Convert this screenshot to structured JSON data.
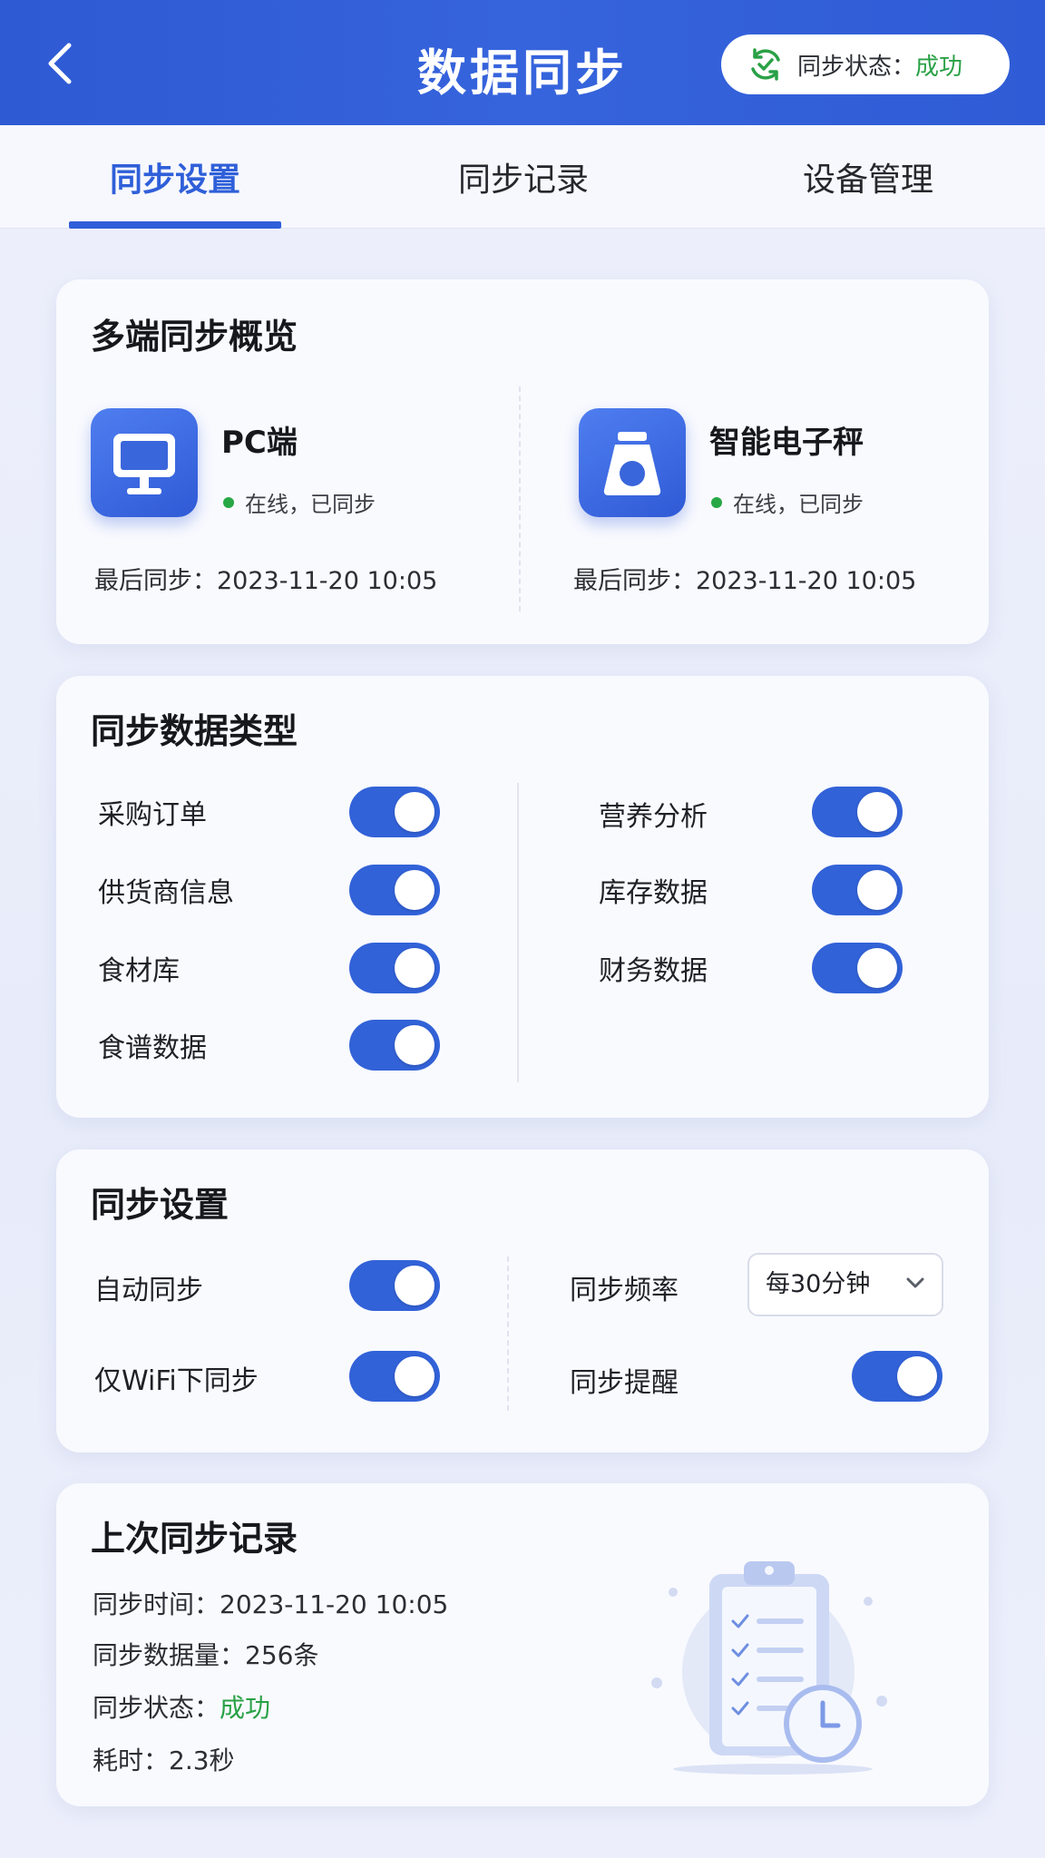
{
  "header": {
    "title": "数据同步",
    "status_label": "同步状态：",
    "status_value": "成功"
  },
  "tabs": [
    {
      "label": "同步设置",
      "active": true
    },
    {
      "label": "同步记录",
      "active": false
    },
    {
      "label": "设备管理",
      "active": false
    }
  ],
  "overview": {
    "title": "多端同步概览",
    "devices": [
      {
        "name": "PC端",
        "icon": "monitor-icon",
        "status": "在线，已同步",
        "last_sync_label": "最后同步：",
        "last_sync": "2023-11-20 10:05"
      },
      {
        "name": "智能电子秤",
        "icon": "scale-icon",
        "status": "在线，已同步",
        "last_sync_label": "最后同步：",
        "last_sync": "2023-11-20 10:05"
      }
    ]
  },
  "data_types": {
    "title": "同步数据类型",
    "left": [
      {
        "label": "采购订单",
        "on": true
      },
      {
        "label": "供货商信息",
        "on": true
      },
      {
        "label": "食材库",
        "on": true
      },
      {
        "label": "食谱数据",
        "on": true
      }
    ],
    "right": [
      {
        "label": "营养分析",
        "on": true
      },
      {
        "label": "库存数据",
        "on": true
      },
      {
        "label": "财务数据",
        "on": true
      }
    ]
  },
  "settings": {
    "title": "同步设置",
    "auto_sync": {
      "label": "自动同步",
      "on": true
    },
    "wifi_only": {
      "label": "仅WiFi下同步",
      "on": true
    },
    "frequency": {
      "label": "同步频率",
      "value": "每30分钟"
    },
    "reminder": {
      "label": "同步提醒",
      "on": true
    }
  },
  "last_record": {
    "title": "上次同步记录",
    "time_label": "同步时间：",
    "time": "2023-11-20 10:05",
    "amount_label": "同步数据量：",
    "amount": "256条",
    "status_label": "同步状态：",
    "status": "成功",
    "duration_label": "耗时：",
    "duration": "2.3秒"
  },
  "colors": {
    "primary": "#2f5fd9",
    "success": "#2aa146",
    "background": "#edf0fb"
  }
}
